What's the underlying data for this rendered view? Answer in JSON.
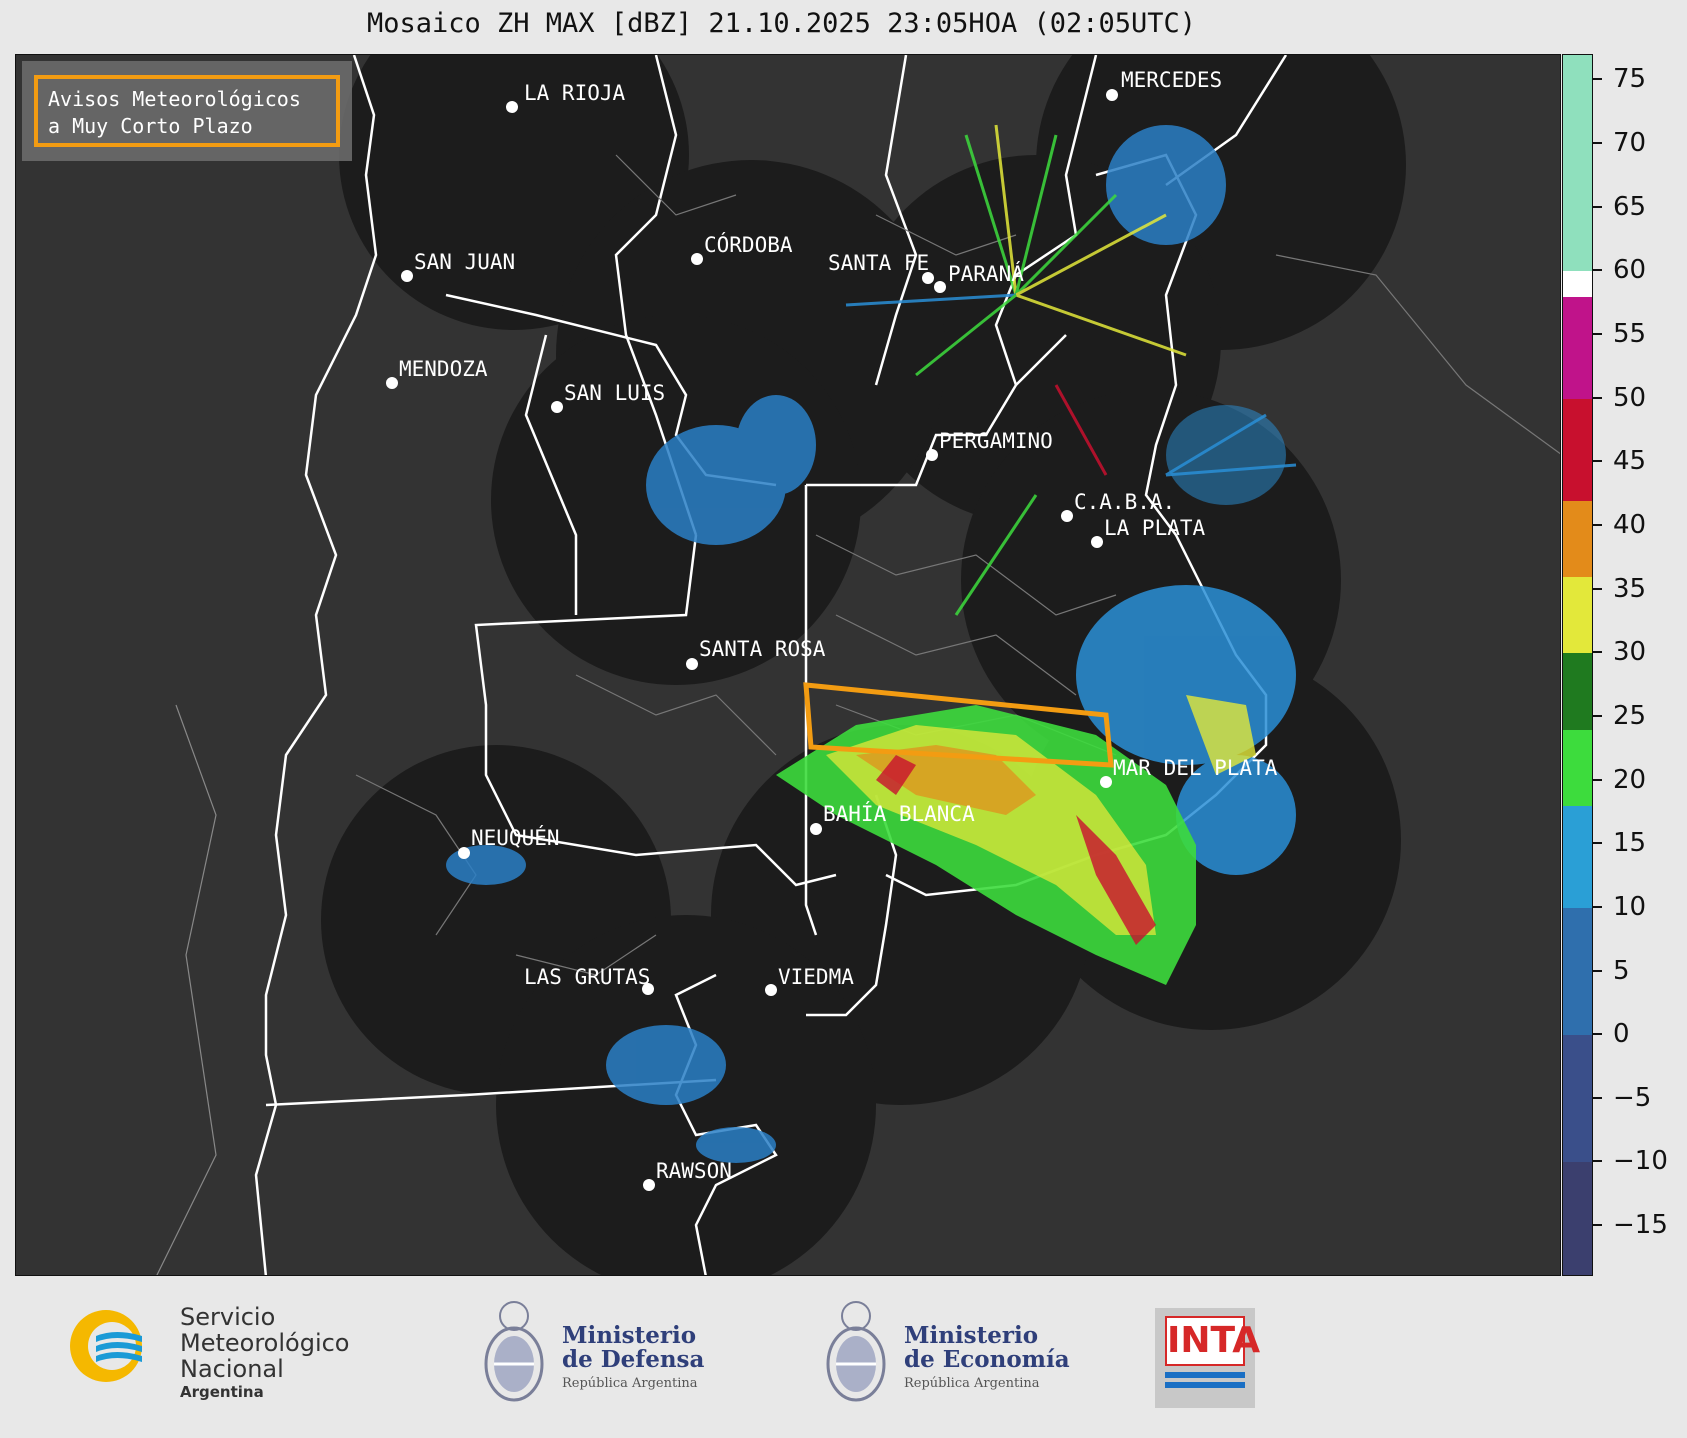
{
  "title": "Mosaico ZH MAX [dBZ] 21.10.2025 23:05HOA (02:05UTC)",
  "warning_box": {
    "line1": "Avisos Meteorológicos",
    "line2": "a Muy Corto Plazo",
    "border_color": "#f39c12"
  },
  "cities": [
    {
      "name": "LA RIOJA"
    },
    {
      "name": "MERCEDES"
    },
    {
      "name": "SAN JUAN"
    },
    {
      "name": "CÓRDOBA"
    },
    {
      "name": "SANTA FE"
    },
    {
      "name": "PARANÁ"
    },
    {
      "name": "MENDOZA"
    },
    {
      "name": "SAN LUIS"
    },
    {
      "name": "PERGAMINO"
    },
    {
      "name": "C.A.B.A."
    },
    {
      "name": "LA PLATA"
    },
    {
      "name": "SANTA ROSA"
    },
    {
      "name": "MAR DEL PLATA"
    },
    {
      "name": "BAHÍA BLANCA"
    },
    {
      "name": "NEUQUÉN"
    },
    {
      "name": "LAS GRUTAS"
    },
    {
      "name": "VIEDMA"
    },
    {
      "name": "RAWSON"
    }
  ],
  "colorbar": {
    "unit": "dBZ",
    "min": -19,
    "max": 77,
    "ticks": [
      "75",
      "70",
      "65",
      "60",
      "55",
      "50",
      "45",
      "40",
      "35",
      "30",
      "25",
      "20",
      "15",
      "10",
      "5",
      "0",
      "−5",
      "−10",
      "−15"
    ],
    "tick_values": [
      75,
      70,
      65,
      60,
      55,
      50,
      45,
      40,
      35,
      30,
      25,
      20,
      15,
      10,
      5,
      0,
      -5,
      -10,
      -15
    ],
    "bands": [
      {
        "from": -19,
        "to": -10,
        "color": "#3b3f6e"
      },
      {
        "from": -10,
        "to": 0,
        "color": "#3a4f8a"
      },
      {
        "from": 0,
        "to": 10,
        "color": "#2f6fad"
      },
      {
        "from": 10,
        "to": 18,
        "color": "#2a9fd6"
      },
      {
        "from": 18,
        "to": 24,
        "color": "#3ddc3d"
      },
      {
        "from": 24,
        "to": 30,
        "color": "#1f7a1f"
      },
      {
        "from": 30,
        "to": 36,
        "color": "#e3e83a"
      },
      {
        "from": 36,
        "to": 42,
        "color": "#e38b1a"
      },
      {
        "from": 42,
        "to": 50,
        "color": "#c8102e"
      },
      {
        "from": 50,
        "to": 58,
        "color": "#c0138a"
      },
      {
        "from": 58,
        "to": 60,
        "color": "#ffffff"
      },
      {
        "from": 60,
        "to": 77,
        "color": "#8fe0bd"
      }
    ]
  },
  "footer": {
    "smn": {
      "line1": "Servicio",
      "line2": "Meteorológico",
      "line3": "Nacional",
      "line4": "Argentina"
    },
    "defensa": {
      "line1": "Ministerio",
      "line2": "de Defensa",
      "line3": "República Argentina"
    },
    "economia": {
      "line1": "Ministerio",
      "line2": "de Economía",
      "line3": "República Argentina"
    },
    "inta": {
      "text": "INTA"
    }
  }
}
